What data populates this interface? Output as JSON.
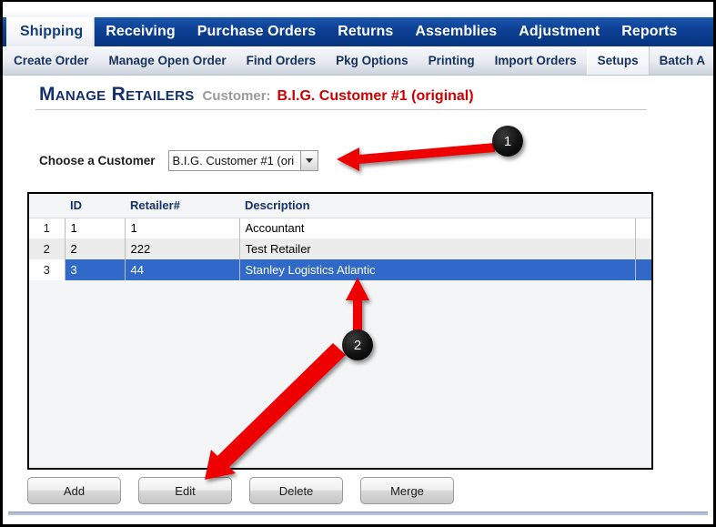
{
  "app": {
    "primary_tabs": [
      {
        "label": "Shipping",
        "active": true
      },
      {
        "label": "Receiving",
        "active": false
      },
      {
        "label": "Purchase Orders",
        "active": false
      },
      {
        "label": "Returns",
        "active": false
      },
      {
        "label": "Assemblies",
        "active": false
      },
      {
        "label": "Adjustment",
        "active": false
      },
      {
        "label": "Reports",
        "active": false
      }
    ],
    "secondary_tabs": [
      {
        "label": "Create Order",
        "active": false
      },
      {
        "label": "Manage Open Order",
        "active": false
      },
      {
        "label": "Find Orders",
        "active": false
      },
      {
        "label": "Pkg Options",
        "active": false
      },
      {
        "label": "Printing",
        "active": false
      },
      {
        "label": "Import Orders",
        "active": false
      },
      {
        "label": "Setups",
        "active": true
      },
      {
        "label": "Batch A",
        "active": false
      }
    ]
  },
  "page": {
    "title": "Manage Retailers",
    "customer_label": "Customer:",
    "customer_value": "B.I.G. Customer #1 (original)"
  },
  "chooser": {
    "label": "Choose a Customer",
    "selected": "B.I.G. Customer #1 (ori",
    "arrow_icon": "chevron-down-icon"
  },
  "grid": {
    "columns": [
      "",
      "ID",
      "Retailer#",
      "Description",
      ""
    ],
    "rows": [
      {
        "num": "1",
        "id": "1",
        "retailer": "1",
        "description": "Accountant",
        "selected": false
      },
      {
        "num": "2",
        "id": "2",
        "retailer": "222",
        "description": "Test Retailer",
        "selected": false
      },
      {
        "num": "3",
        "id": "3",
        "retailer": "44",
        "description": "Stanley Logistics Atlantic",
        "selected": true
      }
    ]
  },
  "actions": [
    {
      "label": "Add"
    },
    {
      "label": "Edit"
    },
    {
      "label": "Delete"
    },
    {
      "label": "Merge"
    }
  ],
  "annotations": [
    {
      "number": "1",
      "target": "customer-dropdown-arrow"
    },
    {
      "number": "2",
      "target": "selected-row-and-edit-button"
    }
  ],
  "colors": {
    "tab_blue": "#0c3f93",
    "title_navy": "#14316a",
    "customer_red": "#d00000",
    "row_select_blue": "#3069c8",
    "annotation_red": "#ee0000"
  }
}
